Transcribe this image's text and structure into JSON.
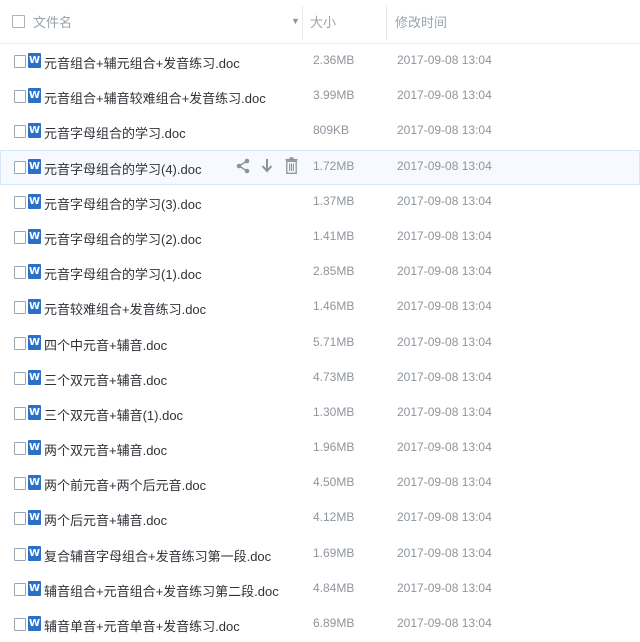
{
  "header": {
    "name_label": "文件名",
    "size_label": "大小",
    "time_label": "修改时间",
    "sort_icon": "sort-down-triangle"
  },
  "rows": [
    {
      "name": "元音组合+辅元组合+发音练习.doc",
      "size": "2.36MB",
      "time": "2017-09-08 13:04"
    },
    {
      "name": "元音组合+辅音较难组合+发音练习.doc",
      "size": "3.99MB",
      "time": "2017-09-08 13:04"
    },
    {
      "name": "元音字母组合的学习.doc",
      "size": "809KB",
      "time": "2017-09-08 13:04"
    },
    {
      "name": "元音字母组合的学习(4).doc",
      "size": "1.72MB",
      "time": "2017-09-08 13:04"
    },
    {
      "name": "元音字母组合的学习(3).doc",
      "size": "1.37MB",
      "time": "2017-09-08 13:04"
    },
    {
      "name": "元音字母组合的学习(2).doc",
      "size": "1.41MB",
      "time": "2017-09-08 13:04"
    },
    {
      "name": "元音字母组合的学习(1).doc",
      "size": "2.85MB",
      "time": "2017-09-08 13:04"
    },
    {
      "name": "元音较难组合+发音练习.doc",
      "size": "1.46MB",
      "time": "2017-09-08 13:04"
    },
    {
      "name": "四个中元音+辅音.doc",
      "size": "5.71MB",
      "time": "2017-09-08 13:04"
    },
    {
      "name": "三个双元音+辅音.doc",
      "size": "4.73MB",
      "time": "2017-09-08 13:04"
    },
    {
      "name": "三个双元音+辅音(1).doc",
      "size": "1.30MB",
      "time": "2017-09-08 13:04"
    },
    {
      "name": "两个双元音+辅音.doc",
      "size": "1.96MB",
      "time": "2017-09-08 13:04"
    },
    {
      "name": "两个前元音+两个后元音.doc",
      "size": "4.50MB",
      "time": "2017-09-08 13:04"
    },
    {
      "name": "两个后元音+辅音.doc",
      "size": "4.12MB",
      "time": "2017-09-08 13:04"
    },
    {
      "name": "复合辅音字母组合+发音练习第一段.doc",
      "size": "1.69MB",
      "time": "2017-09-08 13:04"
    },
    {
      "name": "辅音组合+元音组合+发音练习第二段.doc",
      "size": "4.84MB",
      "time": "2017-09-08 13:04"
    },
    {
      "name": "辅音单音+元音单音+发音练习.doc",
      "size": "6.89MB",
      "time": "2017-09-08 13:04"
    }
  ],
  "file_icon_letter": "W",
  "hover_row_index": 3,
  "hover_actions": [
    "share-icon",
    "download-icon",
    "delete-icon"
  ],
  "colors": {
    "word_icon": "#2b6fc6",
    "hover_bg": "#f6faff"
  }
}
